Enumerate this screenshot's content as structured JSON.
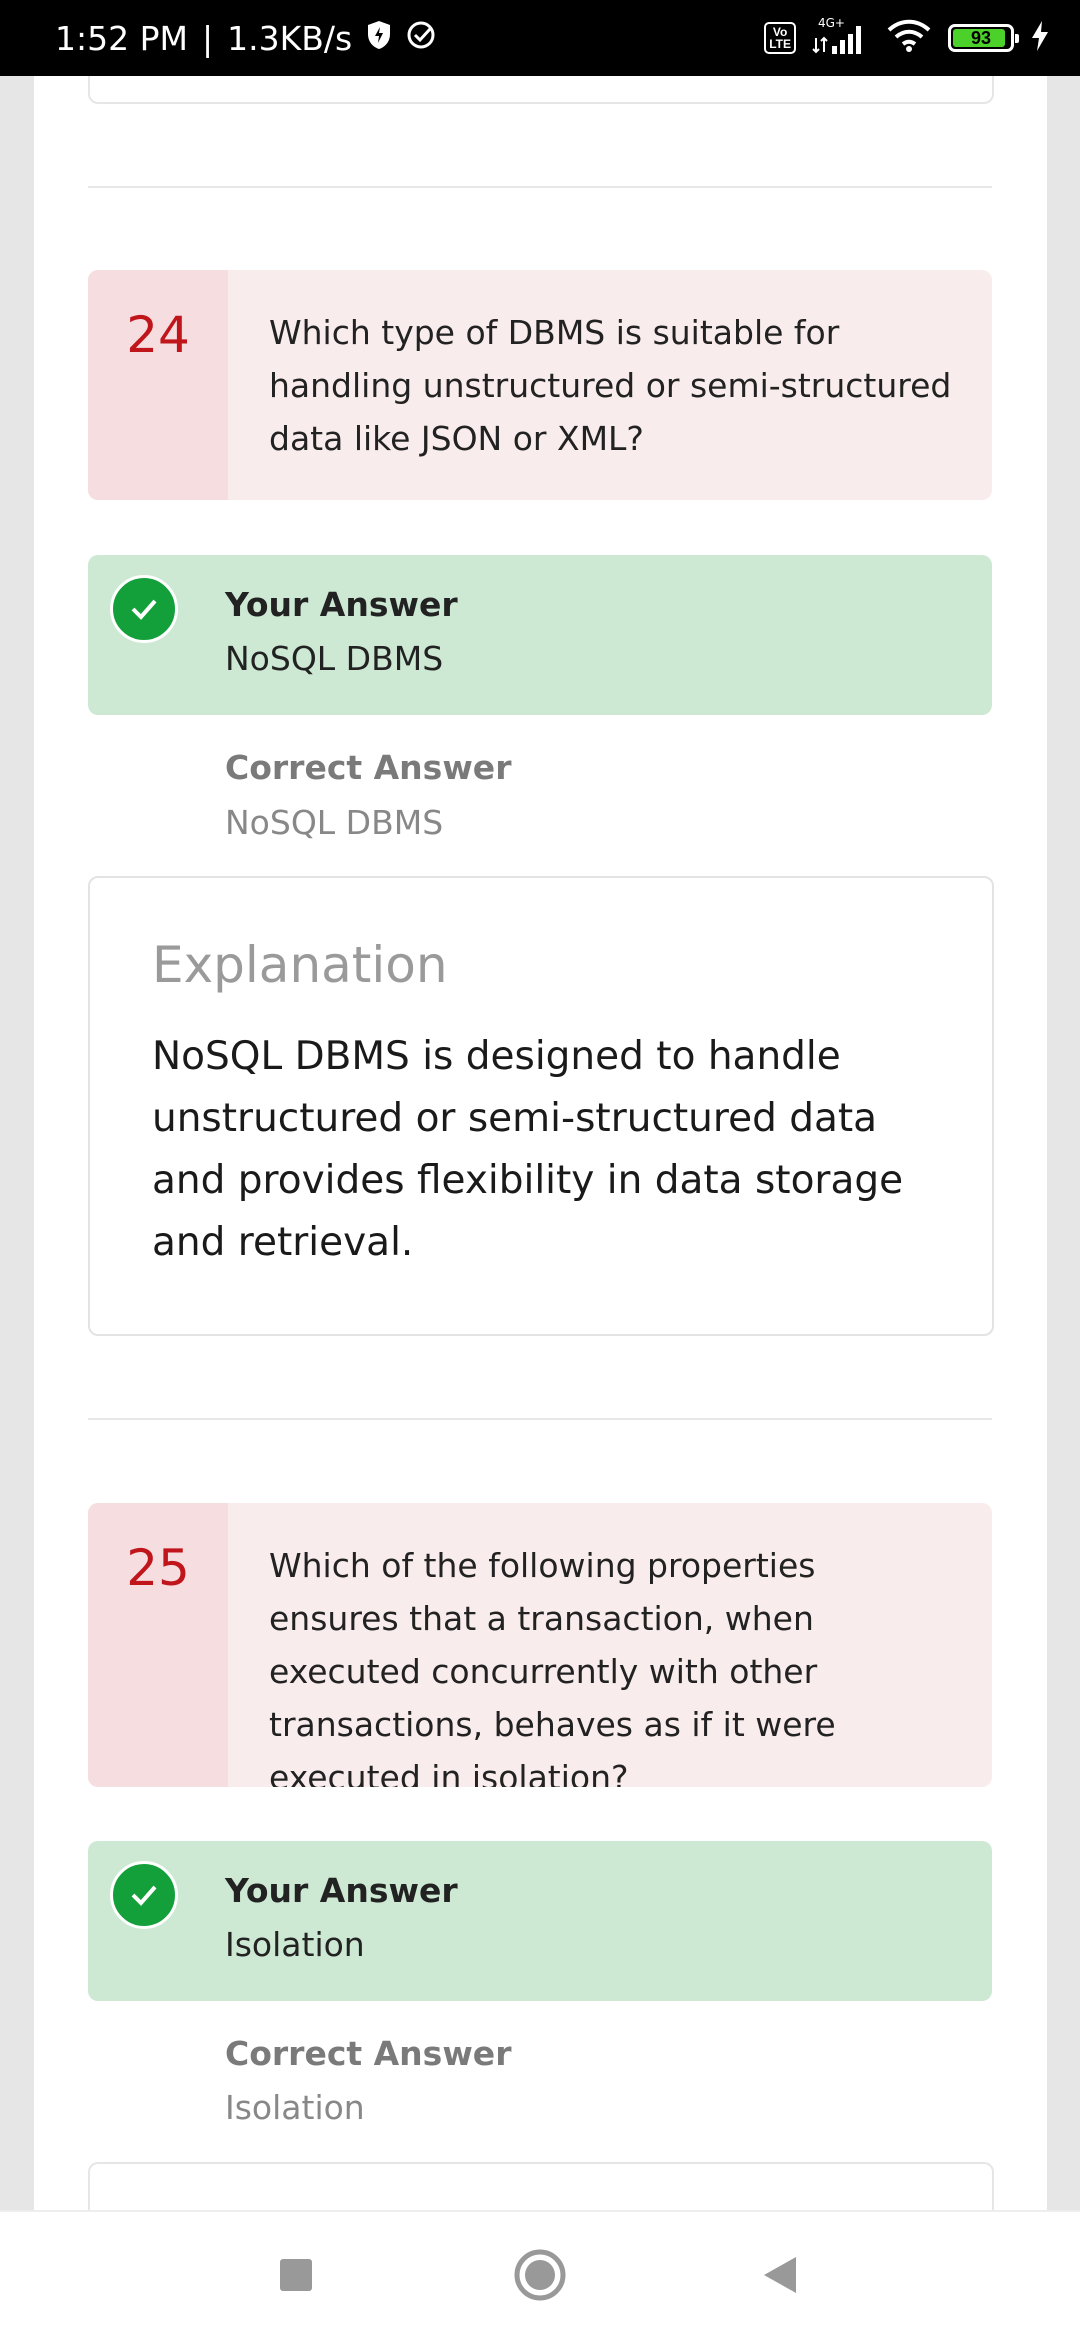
{
  "status_bar": {
    "time": "1:52 PM",
    "separator": "|",
    "speed": "1.3KB/s",
    "volte_label": "Vo\nLTE",
    "network": "4G+",
    "battery_level": "93",
    "icons": [
      "shield-icon",
      "check-circle-icon",
      "volte-icon",
      "signal-icon",
      "wifi-icon",
      "battery-icon",
      "charging-icon"
    ]
  },
  "questions": [
    {
      "number": "24",
      "text": "Which type of DBMS is suitable for handling unstructured or semi-structured data like JSON or XML?",
      "your_answer_label": "Your Answer",
      "your_answer": "NoSQL DBMS",
      "correct_answer_label": "Correct Answer",
      "correct_answer": "NoSQL DBMS",
      "explanation_title": "Explanation",
      "explanation": "NoSQL DBMS is designed to handle unstructured or semi-structured data and provides flexibility in data storage and retrieval."
    },
    {
      "number": "25",
      "text": "Which of the following properties ensures that a transaction, when executed concurrently with other transactions, behaves as if it were executed in isolation?",
      "your_answer_label": "Your Answer",
      "your_answer": "Isolation",
      "correct_answer_label": "Correct Answer",
      "correct_answer": "Isolation"
    }
  ],
  "nav": {
    "icons": [
      "recents-square-icon",
      "home-circle-icon",
      "back-triangle-icon"
    ]
  },
  "colors": {
    "question_number": "#c0151b",
    "question_bg": "#f9ecec",
    "answer_bg": "#cde9d3",
    "check_green": "#13a03a"
  }
}
